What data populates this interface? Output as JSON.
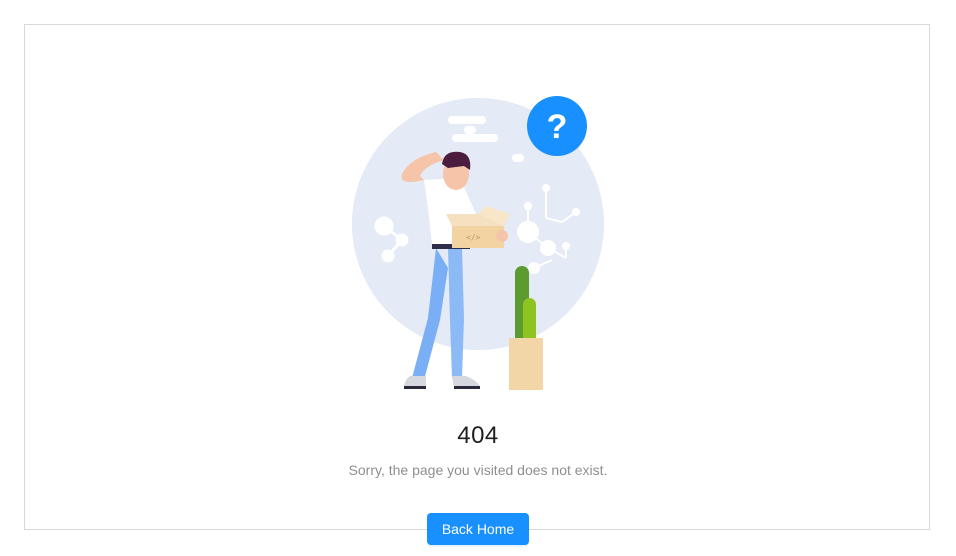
{
  "result": {
    "status_code": "404",
    "subtitle": "Sorry, the page you visited does not exist.",
    "back_button_label": "Back Home"
  },
  "colors": {
    "primary": "#1890ff",
    "illustration_bg": "#e4eaf6",
    "card_border": "#d9d9d9"
  },
  "icons": {
    "question_badge": "question-mark-icon"
  }
}
